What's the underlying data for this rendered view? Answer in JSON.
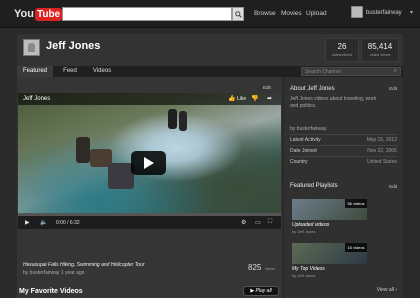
{
  "topbar": {
    "logo_you": "You",
    "logo_tube": "Tube",
    "search_placeholder": "",
    "nav": [
      "Browse",
      "Movies",
      "Upload"
    ],
    "username": "busterfairway"
  },
  "channel": {
    "title": "Jeff Jones",
    "subscribers": "26",
    "subscribers_label": "subscribers",
    "video_views": "85,414",
    "video_views_label": "video views"
  },
  "tabs": [
    {
      "label": "Featured",
      "active": true
    },
    {
      "label": "Feed",
      "active": false
    },
    {
      "label": "Videos",
      "active": false
    }
  ],
  "channel_search_placeholder": "Search Channel",
  "featured": {
    "edit_label": "Edit",
    "overlay_title": "Jeff Jones",
    "like_label": "Like",
    "time": "0:00 / 6:32",
    "title": "Havasupai Falls Hiking, Swimming and Helicopter Tour",
    "meta": "by busterfairway 1 year ago",
    "views": "825",
    "views_label": "views",
    "progress": 0
  },
  "favorites": {
    "title": "My Favorite Videos",
    "play_all": "Play all"
  },
  "about": {
    "title": "About Jeff Jones",
    "edit_label": "Edit",
    "description": "Jeff Jones videos about traveling, work and politics.",
    "by": "by busterfairway",
    "rows": [
      {
        "key": "Latest Activity",
        "value": "May 15, 2012"
      },
      {
        "key": "Date Joined",
        "value": "Nov 22, 2006"
      },
      {
        "key": "Country",
        "value": "United States"
      }
    ]
  },
  "playlists": {
    "title": "Featured Playlists",
    "edit_label": "Edit",
    "items": [
      {
        "count": "56 videos",
        "title": "Uploaded videos",
        "by": "by Jeff Jones"
      },
      {
        "count": "16 videos",
        "title": "My Top Videos",
        "by": "by Jeff Jones"
      }
    ],
    "view_all": "View all"
  },
  "colors": {
    "accent": "#cc0000",
    "background": "#2a2a2a",
    "panel": "#353535"
  }
}
